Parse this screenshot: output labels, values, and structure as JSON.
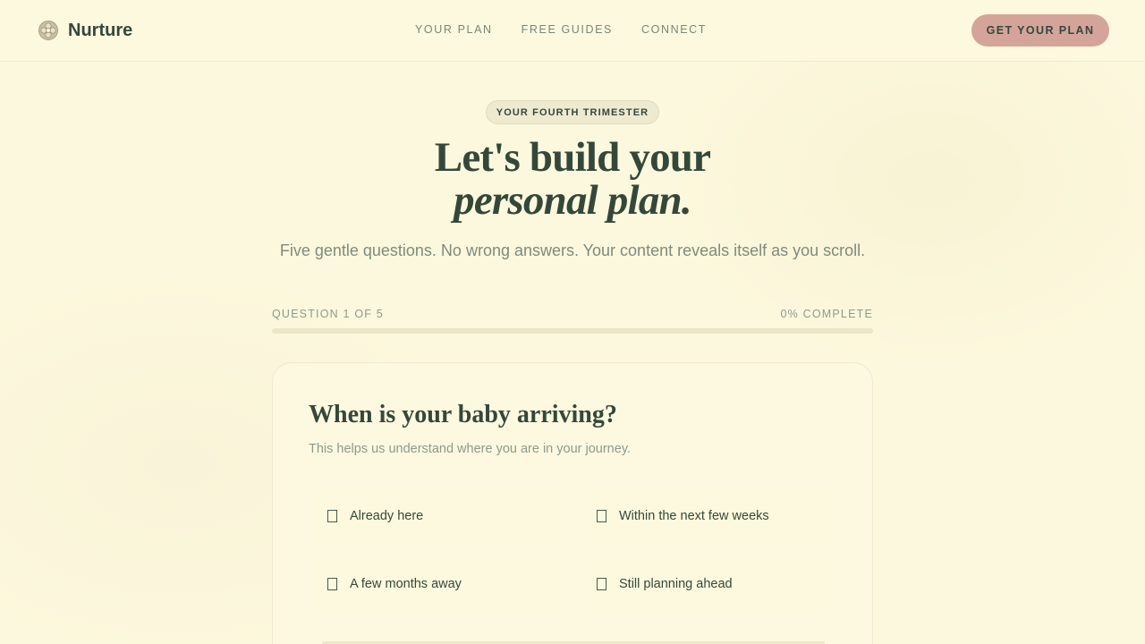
{
  "brand": {
    "name": "Nurture",
    "icon": "flower-logo-icon"
  },
  "nav": {
    "items": [
      "YOUR PLAN",
      "FREE GUIDES",
      "CONNECT"
    ]
  },
  "cta": {
    "label": "GET YOUR PLAN"
  },
  "hero": {
    "eyebrow": "YOUR FOURTH TRIMESTER",
    "title_line1": "Let's build your",
    "title_line2": "personal plan.",
    "subtitle": "Five gentle questions. No wrong answers. Your content reveals itself as you scroll."
  },
  "progress": {
    "question_label": "QUESTION 1 OF 5",
    "complete_label": "0% COMPLETE",
    "percent": 0
  },
  "question": {
    "title": "When is your baby arriving?",
    "description": "This helps us understand where you are in your journey.",
    "options": [
      "Already here",
      "Within the next few weeks",
      "A few months away",
      "Still planning ahead"
    ]
  },
  "colors": {
    "background": "#fcf8dd",
    "accent": "#d4a49a",
    "text": "#34483a",
    "muted": "#8e9a8c"
  }
}
